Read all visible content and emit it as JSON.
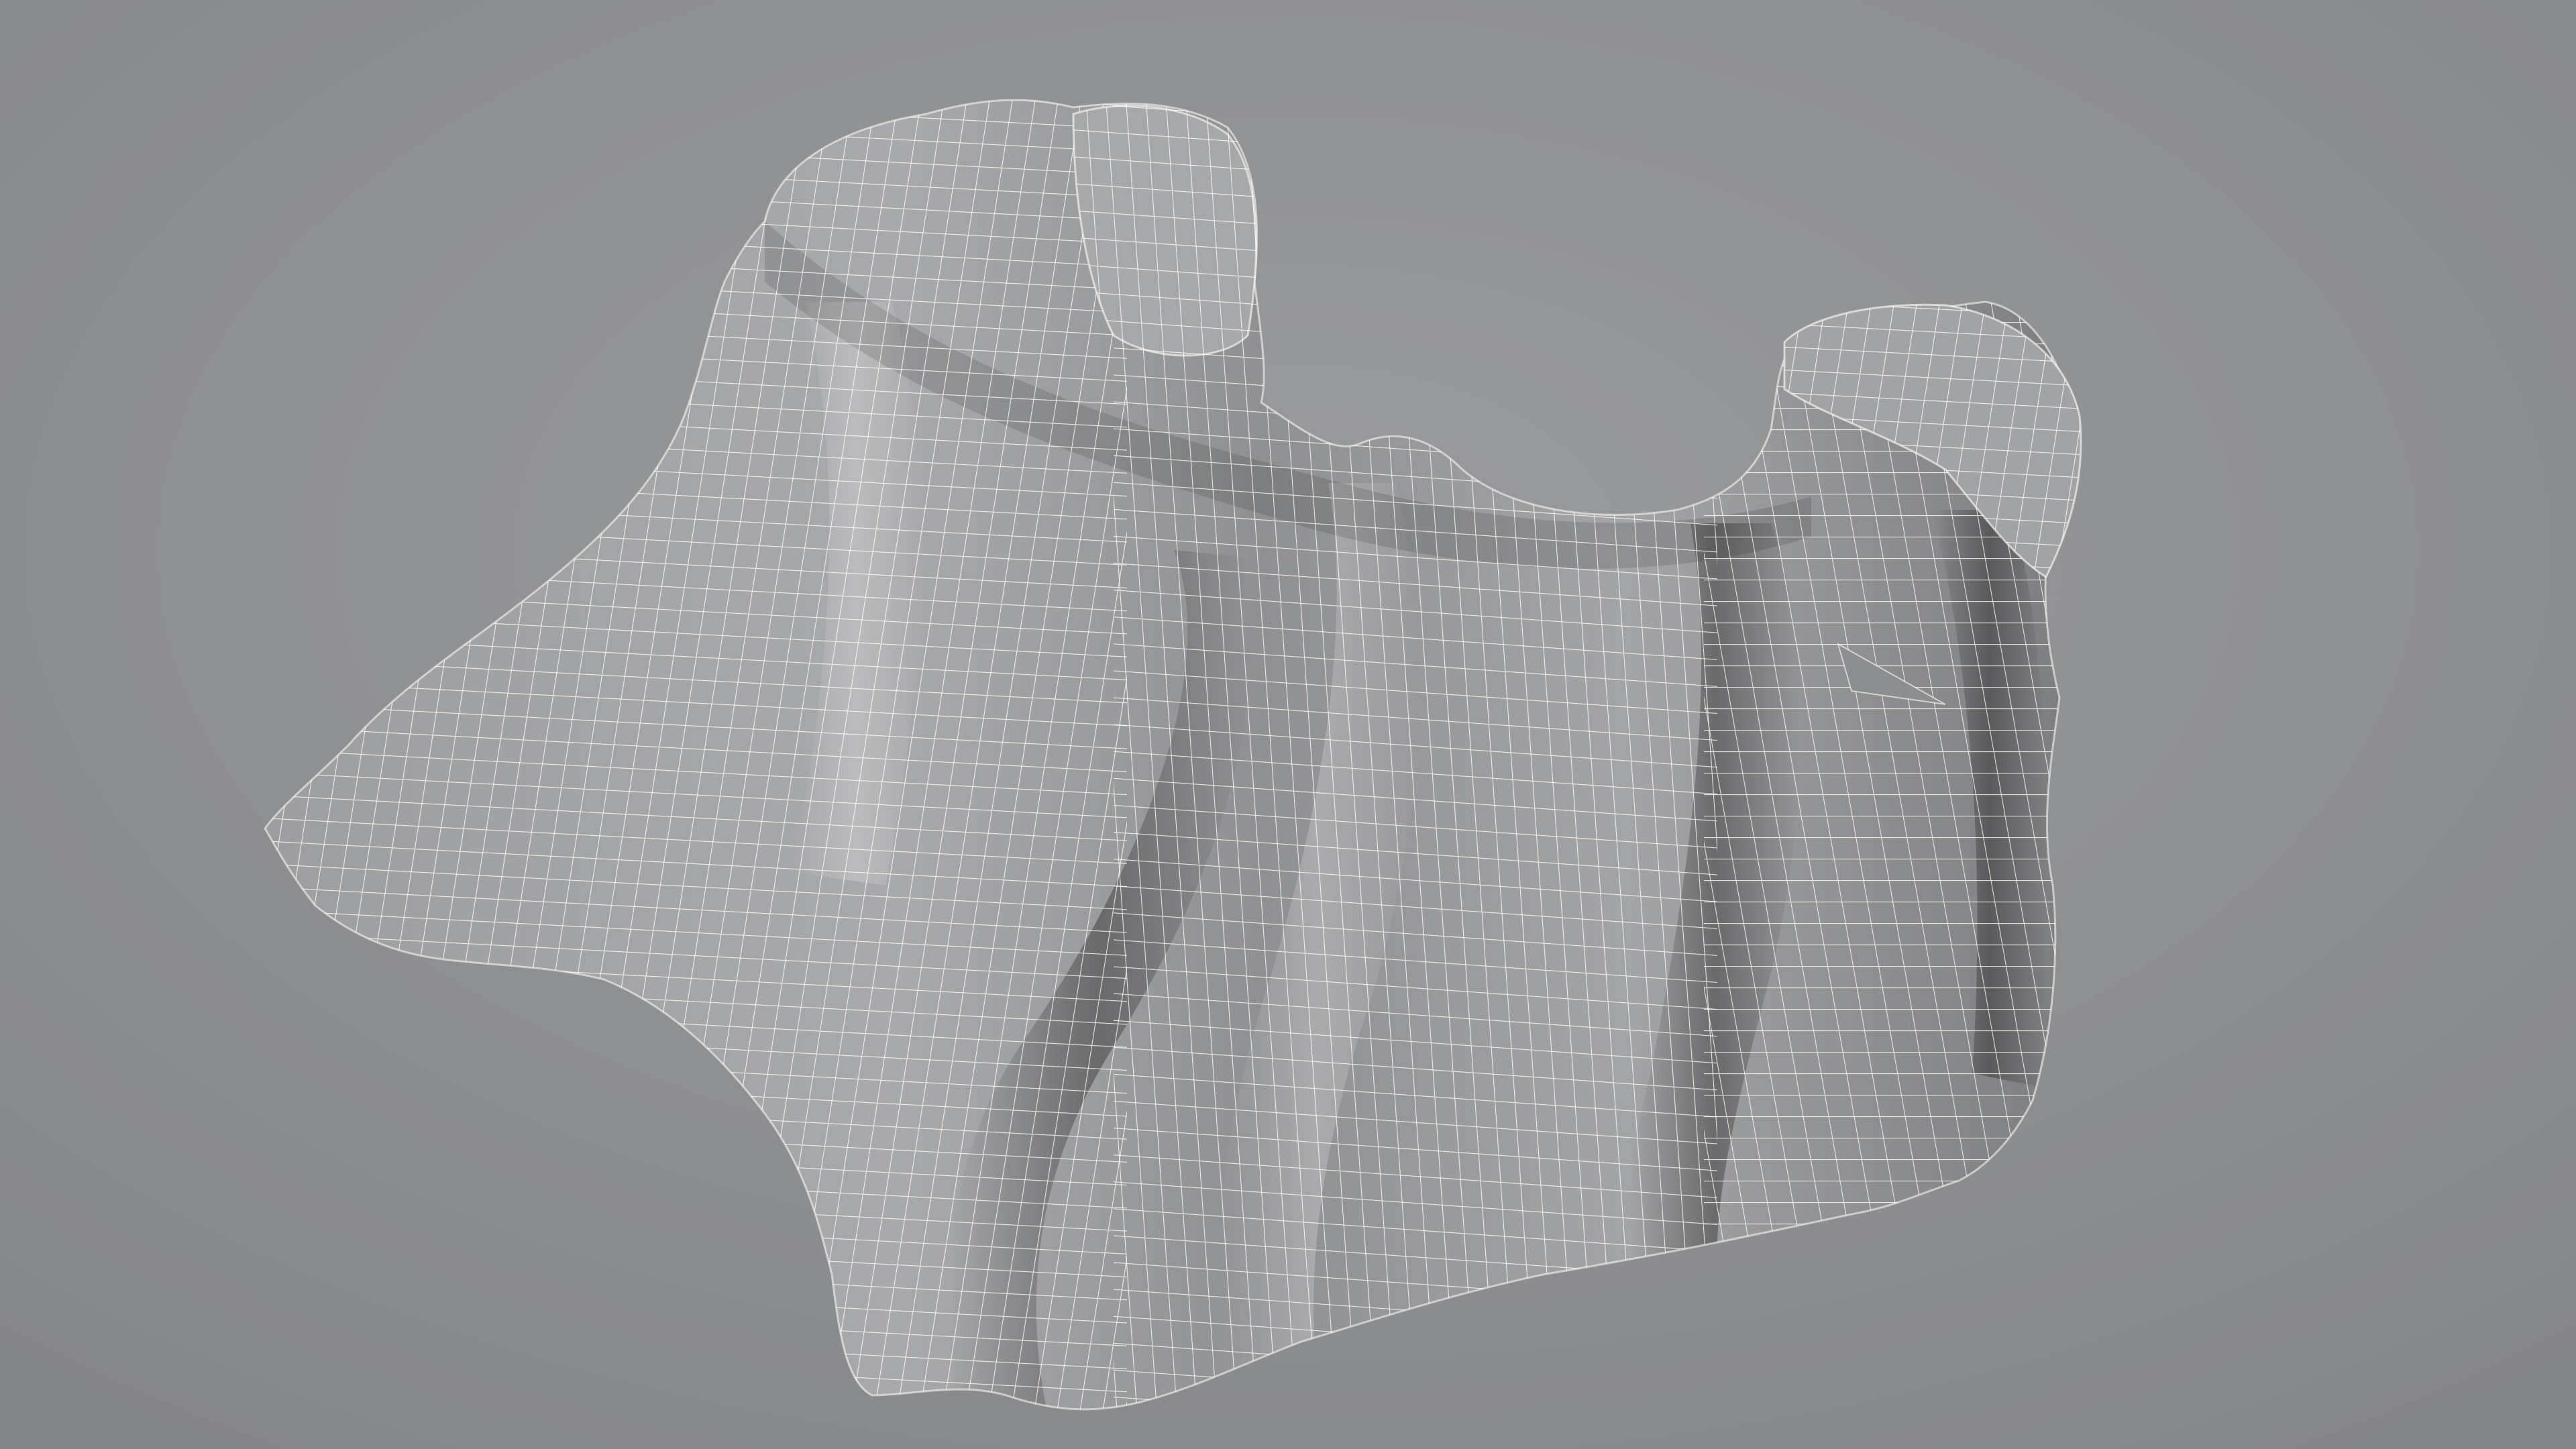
{
  "scene": {
    "background_color": "#8e8f91",
    "mesh_color": "#9fa0a2",
    "wireframe_color": "#ffffff",
    "object": "draped-cloth-mesh",
    "view_mode": "shaded-wireframe"
  }
}
